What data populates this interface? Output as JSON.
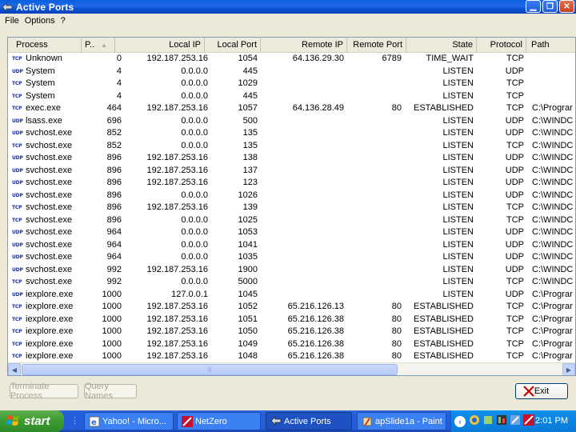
{
  "window": {
    "title": "Active Ports"
  },
  "menu": [
    "File",
    "Options",
    "?"
  ],
  "columns": [
    {
      "key": "process",
      "label": "Process"
    },
    {
      "key": "pid",
      "label": "P.."
    },
    {
      "key": "local_ip",
      "label": "Local IP"
    },
    {
      "key": "local_port",
      "label": "Local Port"
    },
    {
      "key": "remote_ip",
      "label": "Remote IP"
    },
    {
      "key": "remote_port",
      "label": "Remote Port"
    },
    {
      "key": "state",
      "label": "State"
    },
    {
      "key": "protocol",
      "label": "Protocol"
    },
    {
      "key": "path",
      "label": "Path"
    }
  ],
  "rows": [
    {
      "icon": "TCP",
      "process": "Unknown",
      "pid": "0",
      "local_ip": "192.187.253.16",
      "local_port": "1054",
      "remote_ip": "64.136.29.30",
      "remote_port": "6789",
      "state": "TIME_WAIT",
      "protocol": "TCP",
      "path": ""
    },
    {
      "icon": "UDP",
      "process": "System",
      "pid": "4",
      "local_ip": "0.0.0.0",
      "local_port": "445",
      "remote_ip": "",
      "remote_port": "",
      "state": "LISTEN",
      "protocol": "UDP",
      "path": ""
    },
    {
      "icon": "TCP",
      "process": "System",
      "pid": "4",
      "local_ip": "0.0.0.0",
      "local_port": "1029",
      "remote_ip": "",
      "remote_port": "",
      "state": "LISTEN",
      "protocol": "TCP",
      "path": ""
    },
    {
      "icon": "TCP",
      "process": "System",
      "pid": "4",
      "local_ip": "0.0.0.0",
      "local_port": "445",
      "remote_ip": "",
      "remote_port": "",
      "state": "LISTEN",
      "protocol": "TCP",
      "path": ""
    },
    {
      "icon": "TCP",
      "process": "exec.exe",
      "pid": "464",
      "local_ip": "192.187.253.16",
      "local_port": "1057",
      "remote_ip": "64.136.28.49",
      "remote_port": "80",
      "state": "ESTABLISHED",
      "protocol": "TCP",
      "path": "C:\\Prograr"
    },
    {
      "icon": "UDP",
      "process": "lsass.exe",
      "pid": "696",
      "local_ip": "0.0.0.0",
      "local_port": "500",
      "remote_ip": "",
      "remote_port": "",
      "state": "LISTEN",
      "protocol": "UDP",
      "path": "C:\\WINDC"
    },
    {
      "icon": "UDP",
      "process": "svchost.exe",
      "pid": "852",
      "local_ip": "0.0.0.0",
      "local_port": "135",
      "remote_ip": "",
      "remote_port": "",
      "state": "LISTEN",
      "protocol": "UDP",
      "path": "C:\\WINDC"
    },
    {
      "icon": "TCP",
      "process": "svchost.exe",
      "pid": "852",
      "local_ip": "0.0.0.0",
      "local_port": "135",
      "remote_ip": "",
      "remote_port": "",
      "state": "LISTEN",
      "protocol": "TCP",
      "path": "C:\\WINDC"
    },
    {
      "icon": "UDP",
      "process": "svchost.exe",
      "pid": "896",
      "local_ip": "192.187.253.16",
      "local_port": "138",
      "remote_ip": "",
      "remote_port": "",
      "state": "LISTEN",
      "protocol": "UDP",
      "path": "C:\\WINDC"
    },
    {
      "icon": "UDP",
      "process": "svchost.exe",
      "pid": "896",
      "local_ip": "192.187.253.16",
      "local_port": "137",
      "remote_ip": "",
      "remote_port": "",
      "state": "LISTEN",
      "protocol": "UDP",
      "path": "C:\\WINDC"
    },
    {
      "icon": "UDP",
      "process": "svchost.exe",
      "pid": "896",
      "local_ip": "192.187.253.16",
      "local_port": "123",
      "remote_ip": "",
      "remote_port": "",
      "state": "LISTEN",
      "protocol": "UDP",
      "path": "C:\\WINDC"
    },
    {
      "icon": "UDP",
      "process": "svchost.exe",
      "pid": "896",
      "local_ip": "0.0.0.0",
      "local_port": "1026",
      "remote_ip": "",
      "remote_port": "",
      "state": "LISTEN",
      "protocol": "UDP",
      "path": "C:\\WINDC"
    },
    {
      "icon": "TCP",
      "process": "svchost.exe",
      "pid": "896",
      "local_ip": "192.187.253.16",
      "local_port": "139",
      "remote_ip": "",
      "remote_port": "",
      "state": "LISTEN",
      "protocol": "TCP",
      "path": "C:\\WINDC"
    },
    {
      "icon": "TCP",
      "process": "svchost.exe",
      "pid": "896",
      "local_ip": "0.0.0.0",
      "local_port": "1025",
      "remote_ip": "",
      "remote_port": "",
      "state": "LISTEN",
      "protocol": "TCP",
      "path": "C:\\WINDC"
    },
    {
      "icon": "UDP",
      "process": "svchost.exe",
      "pid": "964",
      "local_ip": "0.0.0.0",
      "local_port": "1053",
      "remote_ip": "",
      "remote_port": "",
      "state": "LISTEN",
      "protocol": "UDP",
      "path": "C:\\WINDC"
    },
    {
      "icon": "UDP",
      "process": "svchost.exe",
      "pid": "964",
      "local_ip": "0.0.0.0",
      "local_port": "1041",
      "remote_ip": "",
      "remote_port": "",
      "state": "LISTEN",
      "protocol": "UDP",
      "path": "C:\\WINDC"
    },
    {
      "icon": "UDP",
      "process": "svchost.exe",
      "pid": "964",
      "local_ip": "0.0.0.0",
      "local_port": "1035",
      "remote_ip": "",
      "remote_port": "",
      "state": "LISTEN",
      "protocol": "UDP",
      "path": "C:\\WINDC"
    },
    {
      "icon": "UDP",
      "process": "svchost.exe",
      "pid": "992",
      "local_ip": "192.187.253.16",
      "local_port": "1900",
      "remote_ip": "",
      "remote_port": "",
      "state": "LISTEN",
      "protocol": "UDP",
      "path": "C:\\WINDC"
    },
    {
      "icon": "TCP",
      "process": "svchost.exe",
      "pid": "992",
      "local_ip": "0.0.0.0",
      "local_port": "5000",
      "remote_ip": "",
      "remote_port": "",
      "state": "LISTEN",
      "protocol": "TCP",
      "path": "C:\\WINDC"
    },
    {
      "icon": "UDP",
      "process": "iexplore.exe",
      "pid": "1000",
      "local_ip": "127.0.0.1",
      "local_port": "1045",
      "remote_ip": "",
      "remote_port": "",
      "state": "LISTEN",
      "protocol": "UDP",
      "path": "C:\\Prograr"
    },
    {
      "icon": "TCP",
      "process": "iexplore.exe",
      "pid": "1000",
      "local_ip": "192.187.253.16",
      "local_port": "1052",
      "remote_ip": "65.216.126.13",
      "remote_port": "80",
      "state": "ESTABLISHED",
      "protocol": "TCP",
      "path": "C:\\Prograr"
    },
    {
      "icon": "TCP",
      "process": "iexplore.exe",
      "pid": "1000",
      "local_ip": "192.187.253.16",
      "local_port": "1051",
      "remote_ip": "65.216.126.38",
      "remote_port": "80",
      "state": "ESTABLISHED",
      "protocol": "TCP",
      "path": "C:\\Prograr"
    },
    {
      "icon": "TCP",
      "process": "iexplore.exe",
      "pid": "1000",
      "local_ip": "192.187.253.16",
      "local_port": "1050",
      "remote_ip": "65.216.126.38",
      "remote_port": "80",
      "state": "ESTABLISHED",
      "protocol": "TCP",
      "path": "C:\\Prograr"
    },
    {
      "icon": "TCP",
      "process": "iexplore.exe",
      "pid": "1000",
      "local_ip": "192.187.253.16",
      "local_port": "1049",
      "remote_ip": "65.216.126.38",
      "remote_port": "80",
      "state": "ESTABLISHED",
      "protocol": "TCP",
      "path": "C:\\Prograr"
    },
    {
      "icon": "TCP",
      "process": "iexplore.exe",
      "pid": "1000",
      "local_ip": "192.187.253.16",
      "local_port": "1048",
      "remote_ip": "65.216.126.38",
      "remote_port": "80",
      "state": "ESTABLISHED",
      "protocol": "TCP",
      "path": "C:\\Prograr"
    }
  ],
  "buttons": {
    "terminate": "Terminate Process",
    "query": "Query Names",
    "exit": "Exit"
  },
  "taskbar": {
    "start": "start",
    "tasks": [
      {
        "label": "Yahoo! - Micro...",
        "icon": "ie-icon"
      },
      {
        "label": "NetZero",
        "icon": "netzero-icon"
      },
      {
        "label": "Active Ports",
        "icon": "active-ports-icon",
        "active": true
      },
      {
        "label": "apSlide1a - Paint",
        "icon": "paint-icon"
      }
    ],
    "clock": "2:01 PM"
  }
}
